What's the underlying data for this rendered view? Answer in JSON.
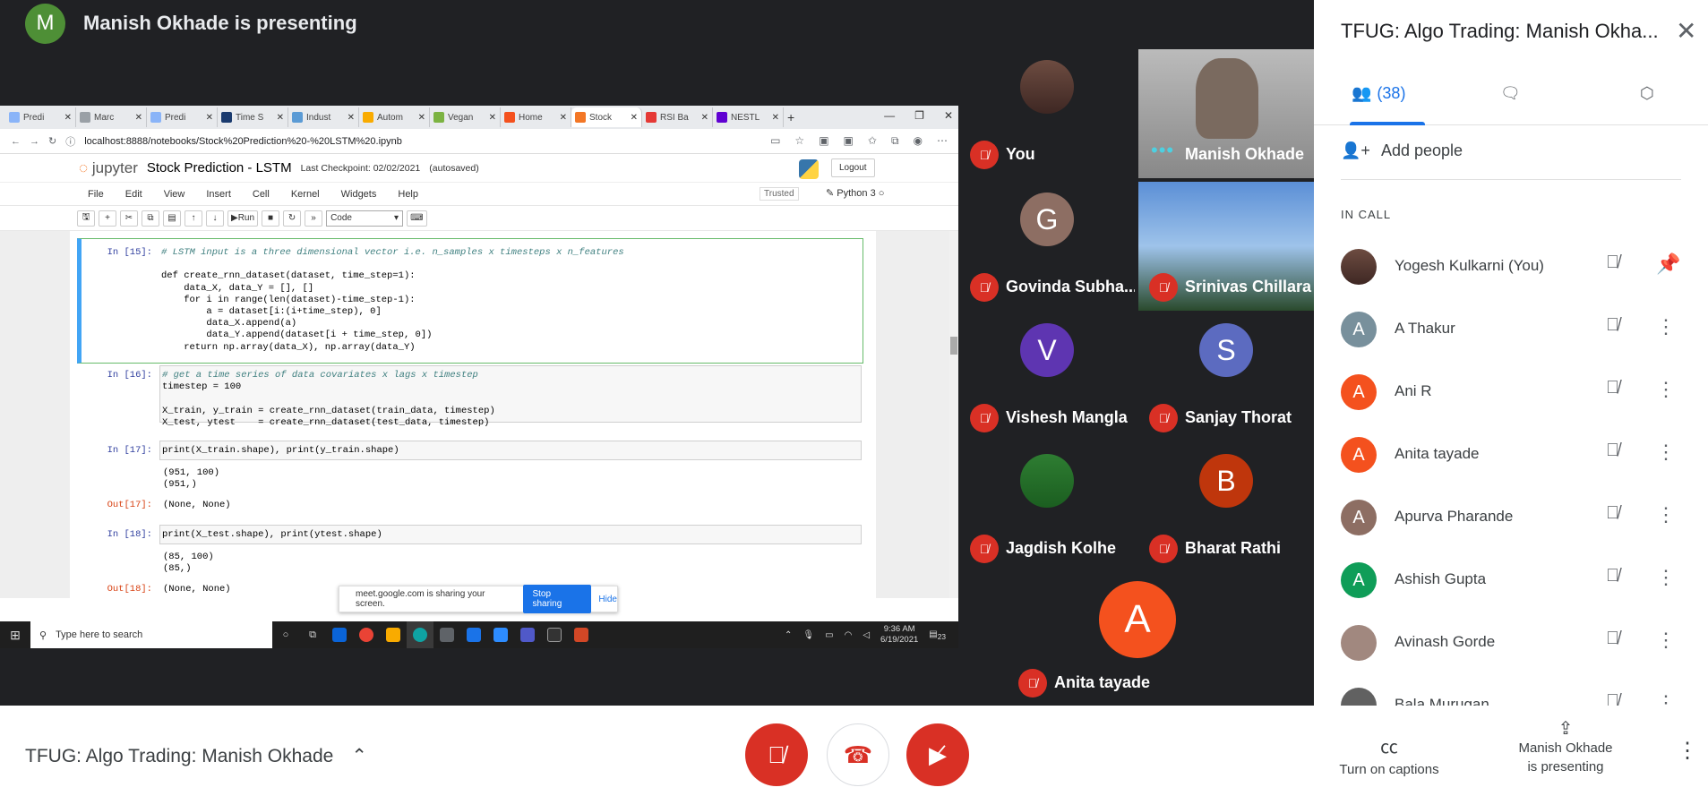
{
  "presenter": {
    "initial": "M",
    "title": "Manish Okhade is presenting",
    "avatar_color": "#4e8f36"
  },
  "browser": {
    "tabs": [
      {
        "label": "Predi",
        "color": "#8ab4f8"
      },
      {
        "label": "Marc",
        "color": "#9aa0a6"
      },
      {
        "label": "Predi",
        "color": "#8ab4f8"
      },
      {
        "label": "Time S",
        "color": "#1a3a6e"
      },
      {
        "label": "Indust",
        "color": "#5b9bd5"
      },
      {
        "label": "Autom",
        "color": "#f9ab00"
      },
      {
        "label": "Vegan",
        "color": "#7cb342"
      },
      {
        "label": "Home",
        "color": "#f4511e"
      },
      {
        "label": "Stock",
        "color": "#f37726",
        "active": true
      },
      {
        "label": "RSI Ba",
        "color": "#e53935"
      },
      {
        "label": "NESTL",
        "color": "#6001d2"
      }
    ],
    "url": "localhost:8888/notebooks/Stock%20Prediction%20-%20LSTM%20.ipynb"
  },
  "jupyter": {
    "logo": "jupyter",
    "notebook_name": "Stock Prediction - LSTM",
    "checkpoint": "Last Checkpoint: 02/02/2021",
    "autosaved": "(autosaved)",
    "logout": "Logout",
    "menu": [
      "File",
      "Edit",
      "View",
      "Insert",
      "Cell",
      "Kernel",
      "Widgets",
      "Help"
    ],
    "trusted": "Trusted",
    "kernel": "Python 3",
    "run_label": "Run",
    "cell_type": "Code"
  },
  "cells": {
    "c15": {
      "prompt": "In [15]:",
      "comment": "# LSTM input is a three dimensional vector i.e. n_samples x timesteps x n_features",
      "l1": "def create_rnn_dataset(dataset, time_step=1):",
      "l2": "    data_X, data_Y = [], []",
      "l3": "    for i in range(len(dataset)-time_step-1):",
      "l4": "        a = dataset[i:(i+time_step), 0]",
      "l5": "        data_X.append(a)",
      "l6": "        data_Y.append(dataset[i + time_step, 0])",
      "l7": "    return np.array(data_X), np.array(data_Y)"
    },
    "c16": {
      "prompt": "In [16]:",
      "comment": "# get a time series of data covariates x lags x timestep",
      "l1": "timestep = 100",
      "l2": "X_train, y_train = create_rnn_dataset(train_data, timestep)",
      "l3": "X_test, ytest    = create_rnn_dataset(test_data, timestep)"
    },
    "c17": {
      "prompt": "In [17]:",
      "code": "print(X_train.shape), print(y_train.shape)",
      "out1": "(951, 100)",
      "out2": "(951,)",
      "out_prompt": "Out[17]:",
      "out_value": "(None, None)"
    },
    "c18": {
      "prompt": "In [18]:",
      "code": "print(X_test.shape), print(ytest.shape)",
      "out1": "(85, 100)",
      "out2": "(85,)",
      "out_prompt": "Out[18]:",
      "out_value": "(None, None)"
    }
  },
  "share_notice": {
    "text": "meet.google.com is sharing your screen.",
    "stop": "Stop sharing",
    "hide": "Hide"
  },
  "taskbar": {
    "search_placeholder": "Type here to search",
    "time": "9:36 AM",
    "date": "6/19/2021",
    "notif": "23"
  },
  "tiles": [
    {
      "name": "You",
      "initial": "",
      "type": "photo",
      "muted": true
    },
    {
      "name": "Manish Okhade",
      "initial": "",
      "type": "video",
      "speaking": true
    },
    {
      "name": "Govinda Subha...",
      "initial": "G",
      "color": "#8d6e63",
      "muted": true
    },
    {
      "name": "Srinivas Chillara",
      "initial": "",
      "type": "landscape",
      "muted": true
    },
    {
      "name": "Vishesh Mangla",
      "initial": "V",
      "color": "#5e35b1",
      "muted": true
    },
    {
      "name": "Sanjay Thorat",
      "initial": "S",
      "color": "#5c6bc0",
      "muted": true
    },
    {
      "name": "Jagdish Kolhe",
      "initial": "",
      "type": "photo",
      "muted": true
    },
    {
      "name": "Bharat Rathi",
      "initial": "B",
      "color": "#bf360c",
      "muted": true
    },
    {
      "name": "Anita tayade",
      "initial": "A",
      "color": "#f4511e",
      "muted": true
    }
  ],
  "panel": {
    "title": "TFUG: Algo Trading: Manish Okha...",
    "people_count": "(38)",
    "add_people": "Add people",
    "in_call": "IN CALL",
    "participants": [
      {
        "name": "Yogesh Kulkarni (You)",
        "initial": "",
        "color": "#6d4c41",
        "action": "pin"
      },
      {
        "name": "A Thakur",
        "initial": "A",
        "color": "#78909c",
        "action": "more"
      },
      {
        "name": "Ani R",
        "initial": "A",
        "color": "#f4511e",
        "action": "more"
      },
      {
        "name": "Anita tayade",
        "initial": "A",
        "color": "#f4511e",
        "action": "more"
      },
      {
        "name": "Apurva Pharande",
        "initial": "A",
        "color": "#8d6e63",
        "action": "more"
      },
      {
        "name": "Ashish Gupta",
        "initial": "A",
        "color": "#0f9d58",
        "action": "more"
      },
      {
        "name": "Avinash Gorde",
        "initial": "",
        "color": "#a1887f",
        "action": "more"
      },
      {
        "name": "Bala Murugan",
        "initial": "",
        "color": "#616161",
        "action": "more"
      }
    ]
  },
  "bottom": {
    "meeting_title": "TFUG: Algo Trading: Manish Okhade",
    "captions": "Turn on captions",
    "presenting_line1": "Manish Okhade",
    "presenting_line2": "is presenting"
  }
}
